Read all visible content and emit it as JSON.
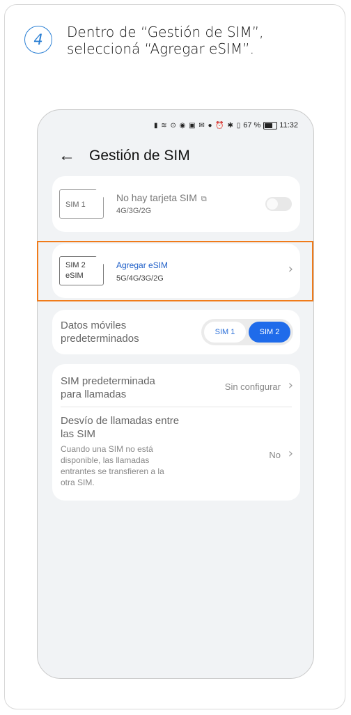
{
  "step": {
    "number": "4",
    "line1": "Dentro de “Gestión de SIM”,",
    "line2": "seleccioná “Agregar eSIM”."
  },
  "status_bar": {
    "icons": "▮ ≋ ⊙ ◉ ▣ ✉ ● ⏰ ✱ ▯",
    "battery": "67 %",
    "time": "11:32"
  },
  "screen": {
    "title": "Gestión de SIM"
  },
  "sim1": {
    "card_label": "SIM 1",
    "title": "No hay tarjeta SIM",
    "networks": "4G/3G/2G"
  },
  "sim2": {
    "card_line1": "SIM 2",
    "card_line2": "eSIM",
    "title": "Agregar eSIM",
    "networks": "5G/4G/3G/2G"
  },
  "mobile_data": {
    "label_line1": "Datos móviles",
    "label_line2": "predeterminados",
    "option1": "SIM 1",
    "option2": "SIM 2",
    "selected": "SIM 2"
  },
  "calls": {
    "label_line1": "SIM predeterminada",
    "label_line2": "para llamadas",
    "value": "Sin configurar"
  },
  "forwarding": {
    "label_line1": "Desvío de llamadas entre",
    "label_line2": "las SIM",
    "desc_line1": "Cuando una SIM no está",
    "desc_line2": "disponible, las llamadas",
    "desc_line3": "entrantes se transfieren a la",
    "desc_line4": "otra SIM.",
    "value": "No"
  },
  "colors": {
    "accent": "#1f6bea",
    "highlight": "#f07b1a",
    "step_circle": "#2a7fd4"
  }
}
